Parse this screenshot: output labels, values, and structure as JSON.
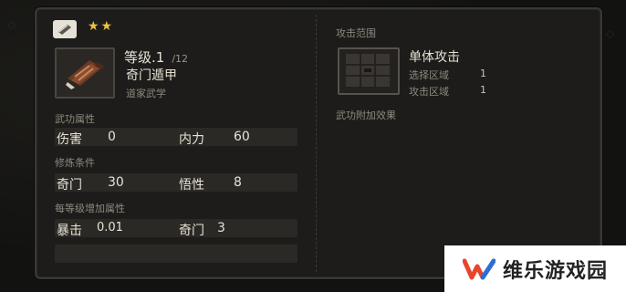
{
  "card": {
    "stars": "★★",
    "level": "等级.1",
    "max_level": "/12",
    "name": "奇门遁甲",
    "school": "道家武学",
    "attributes_label": "武功属性",
    "attributes": [
      {
        "label": "伤害",
        "value": "0"
      },
      {
        "label": "内力",
        "value": "60"
      }
    ],
    "requirements_label": "修炼条件",
    "requirements": [
      {
        "label": "奇门",
        "value": "30"
      },
      {
        "label": "悟性",
        "value": "8"
      }
    ],
    "per_level_label": "每等级增加属性",
    "per_level": [
      {
        "label": "暴击",
        "value": "0.01"
      },
      {
        "label": "奇门",
        "value": "3"
      }
    ],
    "attack_range_label": "攻击范围",
    "attack_type": "单体攻击",
    "select_area_label": "选择区域",
    "select_area_value": "1",
    "attack_area_label": "攻击区域",
    "attack_area_value": "1",
    "extra_effects_label": "武功附加效果"
  },
  "watermark": {
    "text": "维乐游戏园",
    "colors": {
      "logo_red": "#e8452c",
      "logo_blue": "#2a6fd6"
    }
  },
  "icons": {
    "type_icon": "scroll-icon",
    "item_icon": "armor-bundle-icon"
  },
  "colors": {
    "star": "#e8c24a",
    "panel_bg": "#1d1c1a",
    "stat_bar": "#2b2926"
  }
}
